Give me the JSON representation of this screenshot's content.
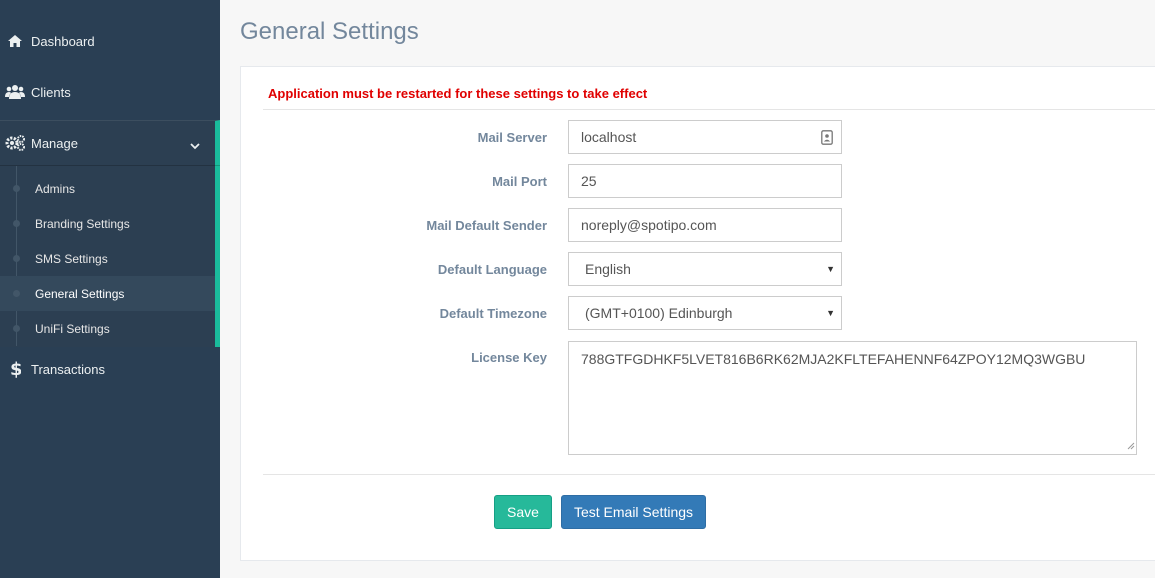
{
  "sidebar": {
    "dashboard": {
      "label": "Dashboard",
      "icon": "home-icon"
    },
    "clients": {
      "label": "Clients",
      "icon": "users-icon"
    },
    "manage": {
      "label": "Manage",
      "icon": "gears-icon",
      "expanded": true
    },
    "manage_items": [
      {
        "label": "Admins",
        "active": false
      },
      {
        "label": "Branding Settings",
        "active": false
      },
      {
        "label": "SMS Settings",
        "active": false
      },
      {
        "label": "General Settings",
        "active": true
      },
      {
        "label": "UniFi Settings",
        "active": false
      }
    ],
    "transactions": {
      "label": "Transactions",
      "icon": "dollar-icon"
    },
    "accent_color": "#1abb9c"
  },
  "page": {
    "title": "General Settings",
    "warning": "Application must be restarted for these settings to take effect"
  },
  "form": {
    "mail_server": {
      "label": "Mail Server",
      "value": "localhost"
    },
    "mail_port": {
      "label": "Mail Port",
      "value": "25"
    },
    "mail_default_sender": {
      "label": "Mail Default Sender",
      "value": "noreply@spotipo.com"
    },
    "default_language": {
      "label": "Default Language",
      "value": "English"
    },
    "default_timezone": {
      "label": "Default Timezone",
      "value": "(GMT+0100) Edinburgh"
    },
    "license_key": {
      "label": "License Key",
      "value": "788GTFGDHKF5LVET816B6RK62MJA2KFLTEFAHENNF64ZPOY12MQ3WGBU"
    }
  },
  "actions": {
    "save_label": "Save",
    "test_email_label": "Test Email Settings"
  }
}
